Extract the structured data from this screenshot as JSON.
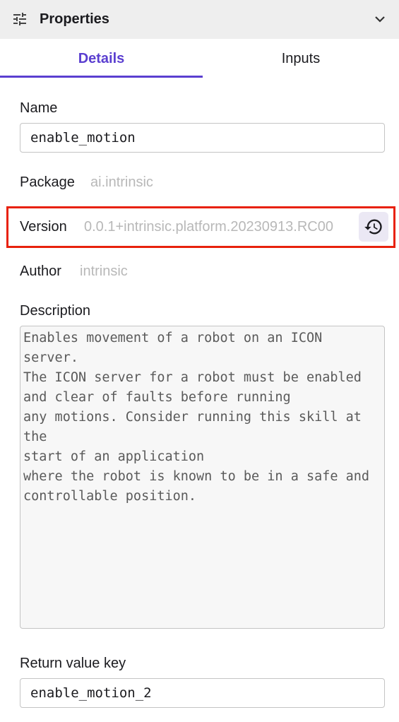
{
  "header": {
    "title": "Properties",
    "left_icon": "tune-icon",
    "right_icon": "chevron-down-icon"
  },
  "tabs": [
    {
      "label": "Details",
      "active": true
    },
    {
      "label": "Inputs",
      "active": false
    }
  ],
  "colors": {
    "accent": "#5b3fd0",
    "highlight_border": "#e8210c",
    "muted_text": "#b8b8b8"
  },
  "fields": {
    "name": {
      "label": "Name",
      "value": "enable_motion"
    },
    "package": {
      "label": "Package",
      "value": "ai.intrinsic"
    },
    "version": {
      "label": "Version",
      "value": "0.0.1+intrinsic.platform.20230913.RC00",
      "action_icon": "history-icon"
    },
    "author": {
      "label": "Author",
      "value": "intrinsic"
    },
    "description": {
      "label": "Description",
      "value": "Enables movement of a robot on an ICON\nserver.\nThe ICON server for a robot must be enabled\nand clear of faults before running\nany motions. Consider running this skill at the\nstart of an application\nwhere the robot is known to be in a safe and\ncontrollable position."
    },
    "return_value_key": {
      "label": "Return value key",
      "value": "enable_motion_2"
    }
  }
}
